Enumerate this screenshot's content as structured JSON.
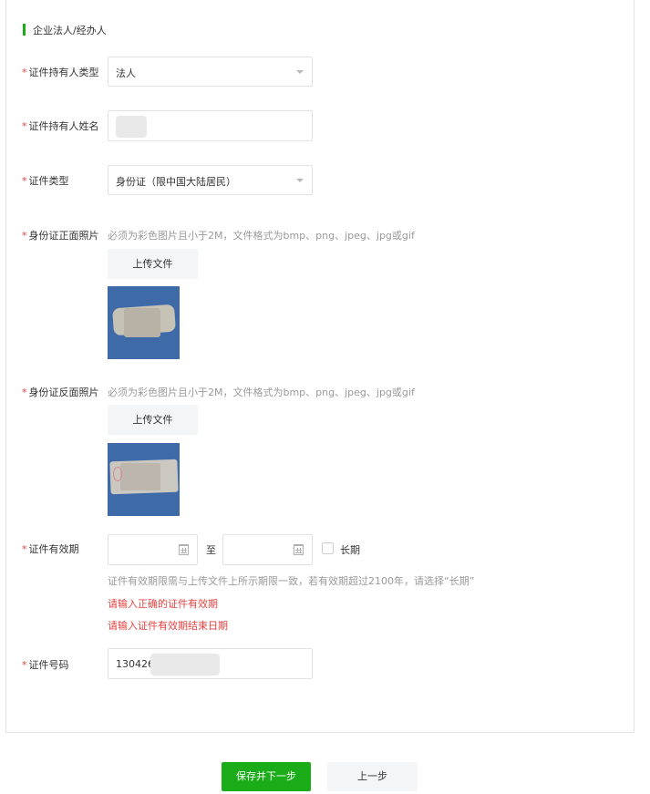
{
  "section": {
    "title": "企业法人/经办人"
  },
  "required_mark": "*",
  "fields": {
    "holder_type": {
      "label": "证件持有人类型",
      "value": "法人"
    },
    "holder_name": {
      "label": "证件持有人姓名",
      "value": ""
    },
    "id_type": {
      "label": "证件类型",
      "value": "身份证（限中国大陆居民）"
    },
    "id_front": {
      "label": "身份证正面照片",
      "hint": "必须为彩色图片且小于2M，文件格式为bmp、png、jpeg、jpg或gif",
      "upload_label": "上传文件"
    },
    "id_back": {
      "label": "身份证反面照片",
      "hint": "必须为彩色图片且小于2M，文件格式为bmp、png、jpeg、jpg或gif",
      "upload_label": "上传文件"
    },
    "validity": {
      "label": "证件有效期",
      "start_value": "",
      "to_text": "至",
      "end_value": "",
      "long_term_label": "长期",
      "long_term_checked": false,
      "hint": "证件有效期限需与上传文件上所示期限一致，若有效期超过2100年，请选择“长期”",
      "errors": [
        "请输入正确的证件有效期",
        "请输入证件有效期结束日期"
      ]
    },
    "id_number": {
      "label": "证件号码",
      "value": "130426"
    }
  },
  "actions": {
    "save_next": "保存并下一步",
    "previous": "上一步"
  },
  "colors": {
    "primary": "#1aad19",
    "error": "#e64340",
    "hint": "#9a9a9a"
  }
}
